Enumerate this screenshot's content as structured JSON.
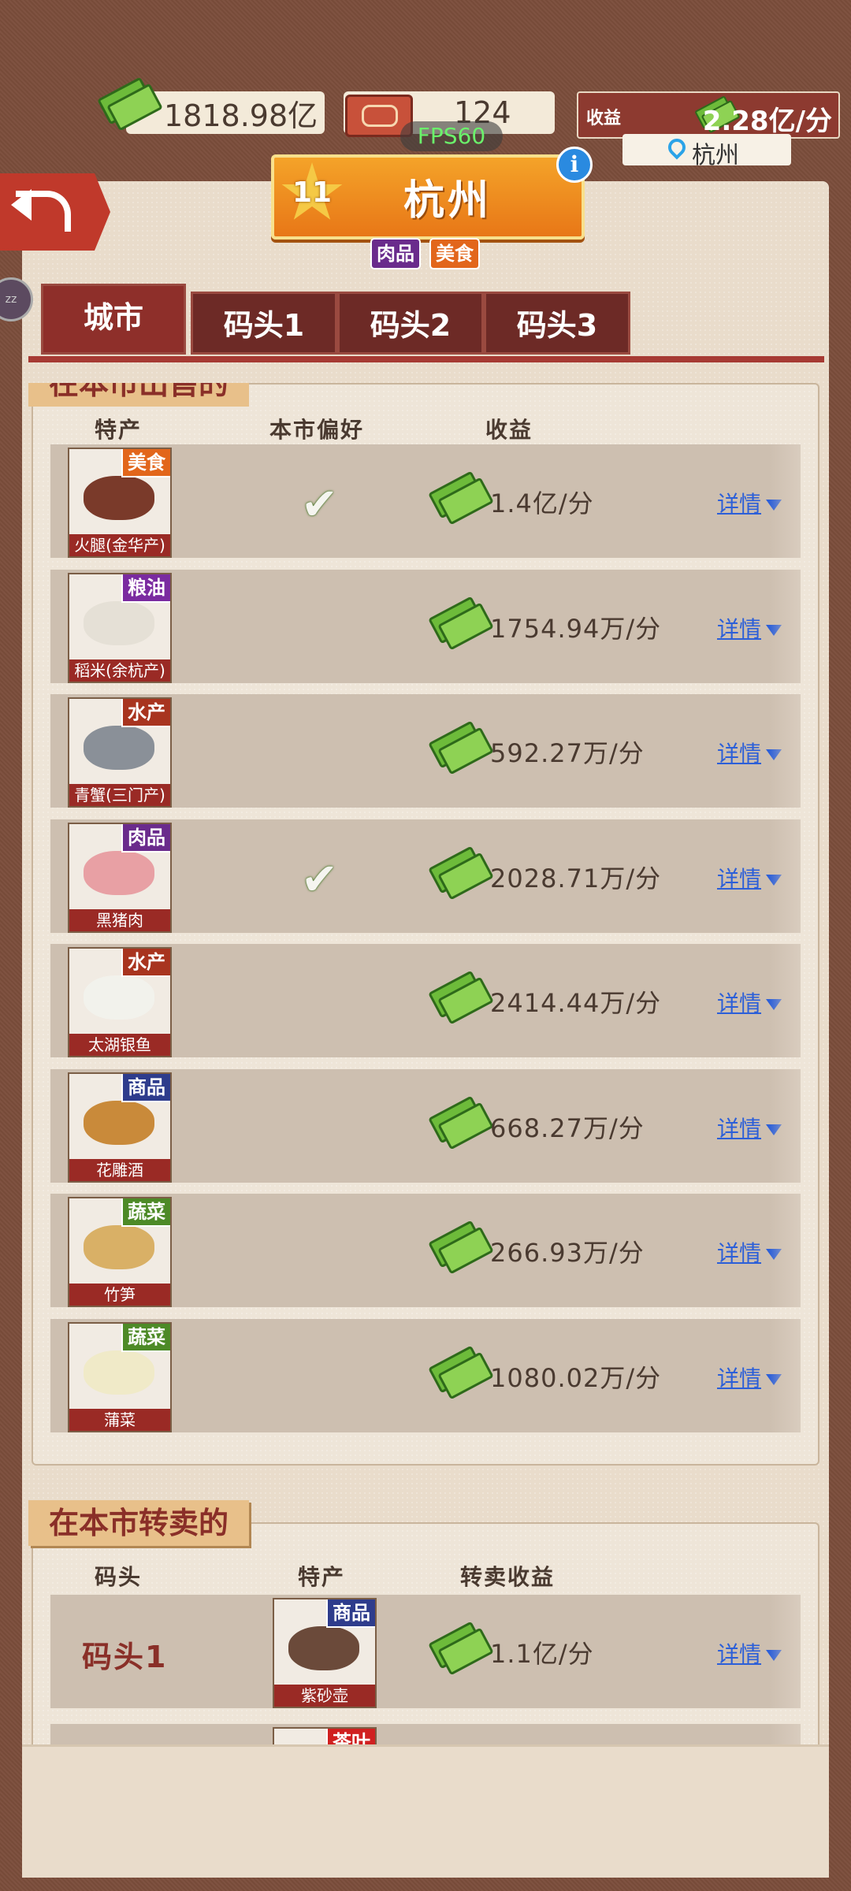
{
  "top_bar": {
    "money": "1818.98亿",
    "tickets": "124",
    "income_label": "收益",
    "income_value": "2.28亿/分",
    "location": "杭州",
    "fps": "FPS60"
  },
  "city": {
    "level": "11",
    "name": "杭州",
    "tags": [
      {
        "label": "肉品",
        "color": "#6a2b8c"
      },
      {
        "label": "美食",
        "color": "#e2661b"
      }
    ]
  },
  "side_bubble": "zz",
  "tabs": [
    "城市",
    "码头1",
    "码头2",
    "码头3"
  ],
  "section1": {
    "title": "在本市出售的",
    "headers": {
      "col1": "特产",
      "col2": "本市偏好",
      "col3": "收益"
    },
    "detail_label": "详情",
    "rows": [
      {
        "name": "火腿(金华产)",
        "category": "美食",
        "cat_color": "#e2661b",
        "art_color": "#7a3a2a",
        "preferred": true,
        "income": "1.4亿/分"
      },
      {
        "name": "稻米(余杭产)",
        "category": "粮油",
        "cat_color": "#7a2ba0",
        "art_color": "#e5e0d6",
        "preferred": false,
        "income": "1754.94万/分"
      },
      {
        "name": "青蟹(三门产)",
        "category": "水产",
        "cat_color": "#a8341f",
        "art_color": "#8a9098",
        "preferred": false,
        "income": "592.27万/分"
      },
      {
        "name": "黑猪肉",
        "category": "肉品",
        "cat_color": "#6a2b8c",
        "art_color": "#e8a0a4",
        "preferred": true,
        "income": "2028.71万/分"
      },
      {
        "name": "太湖银鱼",
        "category": "水产",
        "cat_color": "#a8341f",
        "art_color": "#f2f2ec",
        "preferred": false,
        "income": "2414.44万/分"
      },
      {
        "name": "花雕酒",
        "category": "商品",
        "cat_color": "#2e3c8c",
        "art_color": "#c98a3a",
        "preferred": false,
        "income": "668.27万/分"
      },
      {
        "name": "竹笋",
        "category": "蔬菜",
        "cat_color": "#4d8a27",
        "art_color": "#d9b066",
        "preferred": false,
        "income": "266.93万/分"
      },
      {
        "name": "蒲菜",
        "category": "蔬菜",
        "cat_color": "#4d8a27",
        "art_color": "#f0eac8",
        "preferred": false,
        "income": "1080.02万/分"
      }
    ]
  },
  "section2": {
    "title": "在本市转卖的",
    "headers": {
      "col1": "码头",
      "col2": "特产",
      "col3": "转卖收益"
    },
    "detail_label": "详情",
    "rows": [
      {
        "dock": "码头1",
        "name": "紫砂壶",
        "category": "商品",
        "cat_color": "#2e3c8c",
        "art_color": "#6b4a3a",
        "income": "1.1亿/分"
      },
      {
        "dock": "",
        "name": "",
        "category": "茶叶",
        "cat_color": "#d02020",
        "art_color": "#8aa060",
        "income": ""
      }
    ]
  }
}
